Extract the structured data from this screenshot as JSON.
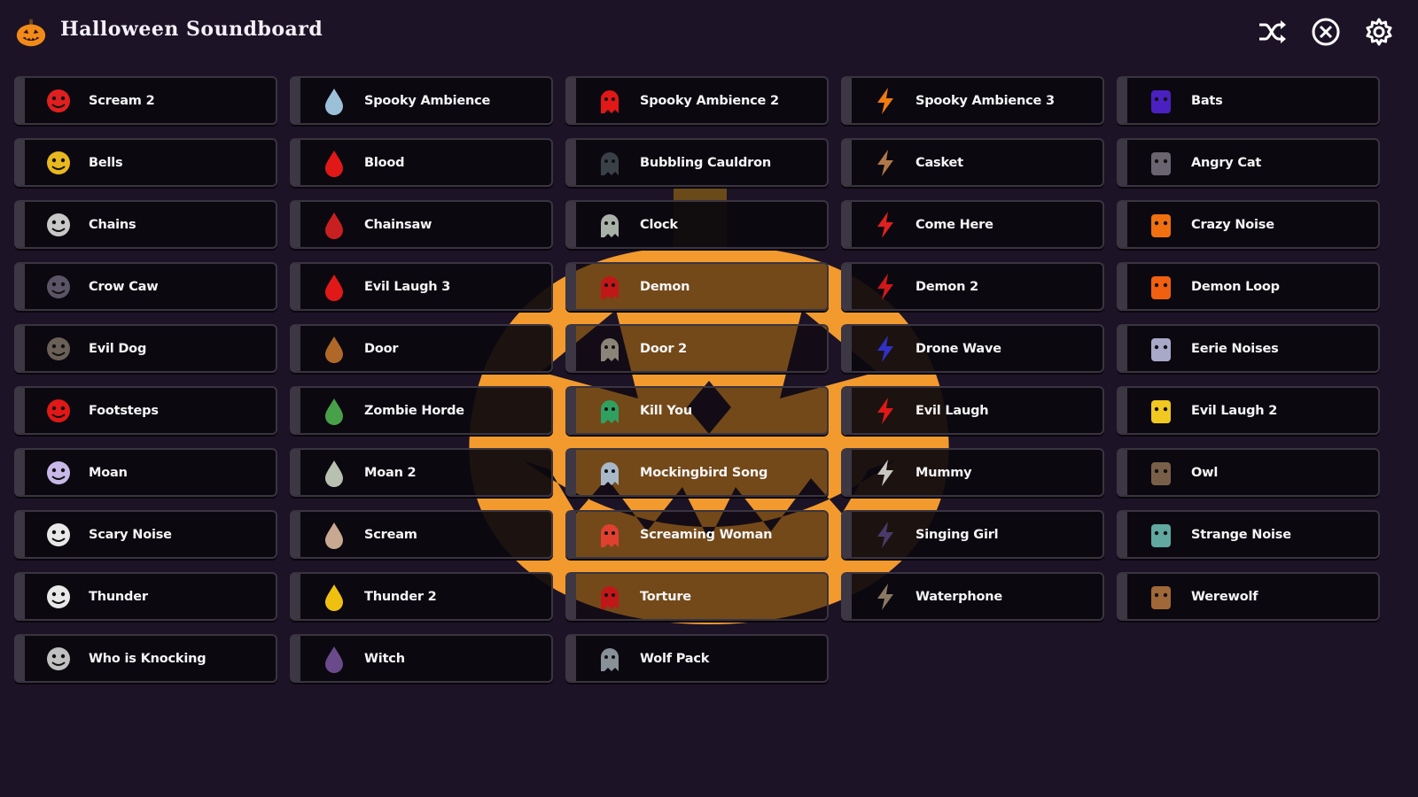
{
  "app": {
    "title": "Halloween Soundboard",
    "logo_icon": "pumpkin-icon",
    "background_icon": "jack-o-lantern-icon"
  },
  "header": {
    "actions": [
      {
        "icon": "shuffle-icon"
      },
      {
        "icon": "stop-circle-icon"
      },
      {
        "icon": "gear-icon"
      }
    ]
  },
  "colors": {
    "background": "#1c1326",
    "button_bg": "#0a080e",
    "button_edge": "#3c3742",
    "pumpkin": "#f29a2e",
    "text": "#f5f5f5"
  },
  "sounds": [
    {
      "label": "Scream 2",
      "icon": "scream-figure-icon",
      "color": "#e02020"
    },
    {
      "label": "Spooky Ambience",
      "icon": "ghost-mask-icon",
      "color": "#9cc0d8"
    },
    {
      "label": "Spooky Ambience 2",
      "icon": "red-face-icon",
      "color": "#e01818"
    },
    {
      "label": "Spooky Ambience 3",
      "icon": "jack-o-lantern-icon",
      "color": "#f07a10"
    },
    {
      "label": "Bats",
      "icon": "bat-icon",
      "color": "#4a20c0"
    },
    {
      "label": "Bells",
      "icon": "bell-icon",
      "color": "#e8b820"
    },
    {
      "label": "Blood",
      "icon": "blood-drop-icon",
      "color": "#e01818"
    },
    {
      "label": "Bubbling Cauldron",
      "icon": "cauldron-icon",
      "color": "#3a4048"
    },
    {
      "label": "Casket",
      "icon": "casket-icon",
      "color": "#b07848"
    },
    {
      "label": "Angry Cat",
      "icon": "angry-cat-icon",
      "color": "#6a6470"
    },
    {
      "label": "Chains",
      "icon": "chain-link-icon",
      "color": "#c8c8c8"
    },
    {
      "label": "Chainsaw",
      "icon": "chainsaw-icon",
      "color": "#c82020"
    },
    {
      "label": "Clock",
      "icon": "clock-icon",
      "color": "#a8b0a8"
    },
    {
      "label": "Come Here",
      "icon": "red-demon-icon",
      "color": "#e02020"
    },
    {
      "label": "Crazy Noise",
      "icon": "crazy-figure-icon",
      "color": "#f07010"
    },
    {
      "label": "Crow Caw",
      "icon": "crow-icon",
      "color": "#5a5466"
    },
    {
      "label": "Evil Laugh 3",
      "icon": "laughing-face-icon",
      "color": "#e01818"
    },
    {
      "label": "Demon",
      "icon": "demon-wings-icon",
      "color": "#c01818"
    },
    {
      "label": "Demon 2",
      "icon": "demon-head-icon",
      "color": "#d01818"
    },
    {
      "label": "Demon Loop",
      "icon": "devil-face-icon",
      "color": "#f06010"
    },
    {
      "label": "Evil Dog",
      "icon": "dog-icon",
      "color": "#6a6058"
    },
    {
      "label": "Door",
      "icon": "door-icon",
      "color": "#b06828"
    },
    {
      "label": "Door 2",
      "icon": "open-door-icon",
      "color": "#8a8478"
    },
    {
      "label": "Drone Wave",
      "icon": "blue-ghost-icon",
      "color": "#3030c8"
    },
    {
      "label": "Eerie Noises",
      "icon": "white-ghost-icon",
      "color": "#a8a8c8"
    },
    {
      "label": "Footsteps",
      "icon": "footprint-icon",
      "color": "#e01818"
    },
    {
      "label": "Zombie Horde",
      "icon": "zombie-hand-icon",
      "color": "#48a048"
    },
    {
      "label": "Kill You",
      "icon": "zombie-head-icon",
      "color": "#30a060"
    },
    {
      "label": "Evil Laugh",
      "icon": "evil-laugh-icon",
      "color": "#e01818"
    },
    {
      "label": "Evil Laugh 2",
      "icon": "smiley-face-icon",
      "color": "#f0c820"
    },
    {
      "label": "Moan",
      "icon": "moaning-ghost-icon",
      "color": "#c8b8e8"
    },
    {
      "label": "Moan 2",
      "icon": "moaning-ghost-2-icon",
      "color": "#b8c0b0"
    },
    {
      "label": "Mockingbird Song",
      "icon": "skull-face-icon",
      "color": "#a8b8c8"
    },
    {
      "label": "Mummy",
      "icon": "mummy-icon",
      "color": "#c8c8c0"
    },
    {
      "label": "Owl",
      "icon": "owl-icon",
      "color": "#786048"
    },
    {
      "label": "Scary Noise",
      "icon": "skull-icon",
      "color": "#e8e8e8"
    },
    {
      "label": "Scream",
      "icon": "screaming-man-icon",
      "color": "#c8a890"
    },
    {
      "label": "Screaming Woman",
      "icon": "screaming-woman-icon",
      "color": "#e04030"
    },
    {
      "label": "Singing Girl",
      "icon": "girl-silhouette-icon",
      "color": "#4a3a6a"
    },
    {
      "label": "Strange Noise",
      "icon": "teal-ghost-icon",
      "color": "#60a8a0"
    },
    {
      "label": "Thunder",
      "icon": "lightning-icon",
      "color": "#e8e8e8"
    },
    {
      "label": "Thunder 2",
      "icon": "yellow-lightning-icon",
      "color": "#f0c010"
    },
    {
      "label": "Torture",
      "icon": "torture-wheel-icon",
      "color": "#c01818"
    },
    {
      "label": "Waterphone",
      "icon": "waterphone-icon",
      "color": "#8a7860"
    },
    {
      "label": "Werewolf",
      "icon": "werewolf-icon",
      "color": "#a06838"
    },
    {
      "label": "Who is Knocking",
      "icon": "knocker-icon",
      "color": "#c0c0c0"
    },
    {
      "label": "Witch",
      "icon": "witch-icon",
      "color": "#6a4a8a"
    },
    {
      "label": "Wolf Pack",
      "icon": "wolf-pack-icon",
      "color": "#889098"
    }
  ]
}
